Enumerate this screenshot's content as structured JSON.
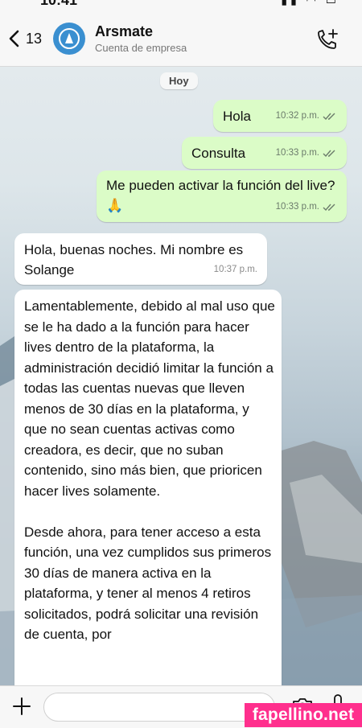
{
  "status": {
    "time": "10:41",
    "icons": "wifi, battery"
  },
  "header": {
    "back_count": "13",
    "title": "Arsmate",
    "subtitle": "Cuenta de empresa"
  },
  "chat": {
    "date_label": "Hoy",
    "messages": [
      {
        "direction": "outgoing",
        "text": "Hola",
        "time": "10:32 p.m.",
        "status": "read"
      },
      {
        "direction": "outgoing",
        "text": "Consulta",
        "time": "10:33 p.m.",
        "status": "read"
      },
      {
        "direction": "outgoing",
        "text": "Me pueden activar la función del live? 🙏",
        "time": "10:33 p.m.",
        "status": "read"
      },
      {
        "direction": "incoming",
        "text": "Hola, buenas noches. Mi nombre es Solange",
        "time": "10:37 p.m."
      },
      {
        "direction": "incoming",
        "text": "Lamentablemente, debido al mal uso que se le ha dado a la función para hacer lives dentro de la plataforma, la administración decidió limitar la función a todas las cuentas nuevas que lleven menos de 30 días en la plataforma, y que no sean cuentas activas como creadora, es decir, que no suban contenido, sino más bien, que prioricen hacer lives solamente.\n\nDesde ahora, para tener acceso a esta función, una vez cumplidos sus primeros 30 días de manera activa en la plataforma, y tener al menos 4 retiros solicitados, podrá solicitar una revisión de cuenta, por"
      }
    ]
  },
  "input": {
    "placeholder": ""
  },
  "watermark": "fapellino.net",
  "colors": {
    "outgoing_bubble": "#dbfcc7",
    "incoming_bubble": "#ffffff",
    "avatar": "#3a8fd0",
    "watermark_bg": "#ff2f8d"
  }
}
